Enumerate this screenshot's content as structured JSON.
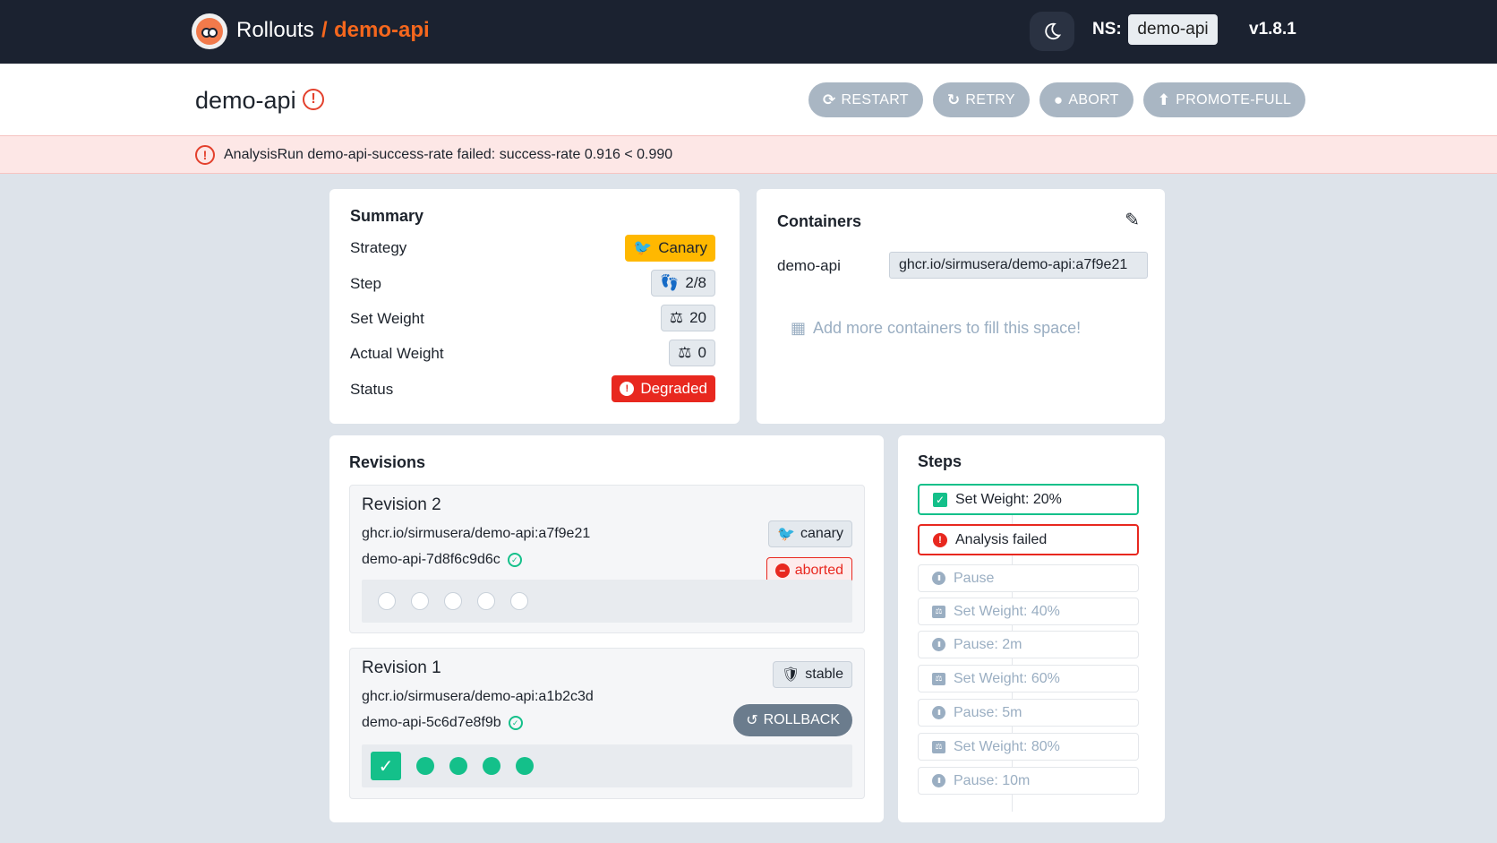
{
  "header": {
    "brand": "Rollouts",
    "separator": "/",
    "app_name": "demo-api",
    "ns_label": "NS:",
    "namespace": "demo-api",
    "version": "v1.8.1"
  },
  "titlebar": {
    "title": "demo-api",
    "actions": [
      {
        "label": "RESTART",
        "icon": "sync-icon"
      },
      {
        "label": "RETRY",
        "icon": "redo-icon"
      },
      {
        "label": "ABORT",
        "icon": "exclamation-circle-icon"
      },
      {
        "label": "PROMOTE-FULL",
        "icon": "arrow-up-circle-icon"
      }
    ]
  },
  "alert": {
    "message": "AnalysisRun demo-api-success-rate failed: success-rate 0.916 < 0.990"
  },
  "summary": {
    "title": "Summary",
    "rows": [
      {
        "label": "Strategy",
        "value": "Canary"
      },
      {
        "label": "Step",
        "value": "2/8"
      },
      {
        "label": "Set Weight",
        "value": "20"
      },
      {
        "label": "Actual Weight",
        "value": "0"
      },
      {
        "label": "Status",
        "value": "Degraded"
      }
    ]
  },
  "containers": {
    "title": "Containers",
    "items": [
      {
        "name": "demo-api",
        "image": "ghcr.io/sirmusera/demo-api:a7f9e21"
      }
    ],
    "hint": "Add more containers to fill this space!"
  },
  "revisions": {
    "title": "Revisions",
    "items": [
      {
        "title": "Revision 2",
        "image": "ghcr.io/sirmusera/demo-api:a7f9e21",
        "replicaset": "demo-api-7d8f6c9d6c",
        "tag": "canary",
        "status": "aborted",
        "pods_ready": 0,
        "pods_total": 5
      },
      {
        "title": "Revision 1",
        "image": "ghcr.io/sirmusera/demo-api:a1b2c3d",
        "replicaset": "demo-api-5c6d7e8f9b",
        "tag": "stable",
        "action": "ROLLBACK",
        "pods_ready": 4,
        "pods_total": 4
      }
    ]
  },
  "steps": {
    "title": "Steps",
    "items": [
      {
        "label": "Set Weight: 20%",
        "state": "complete"
      },
      {
        "label": "Analysis failed",
        "state": "failed"
      },
      {
        "label": "Pause",
        "state": "pending"
      },
      {
        "label": "Set Weight: 40%",
        "state": "pending"
      },
      {
        "label": "Pause: 2m",
        "state": "pending"
      },
      {
        "label": "Set Weight: 60%",
        "state": "pending"
      },
      {
        "label": "Pause: 5m",
        "state": "pending"
      },
      {
        "label": "Set Weight: 80%",
        "state": "pending"
      },
      {
        "label": "Pause: 10m",
        "state": "pending"
      }
    ]
  },
  "colors": {
    "header_bg": "#1b2230",
    "accent_orange": "#f5671d",
    "canary_yellow": "#ffb800",
    "error_red": "#e8281f",
    "success_green": "#14c08a",
    "muted": "#9aaec2"
  }
}
